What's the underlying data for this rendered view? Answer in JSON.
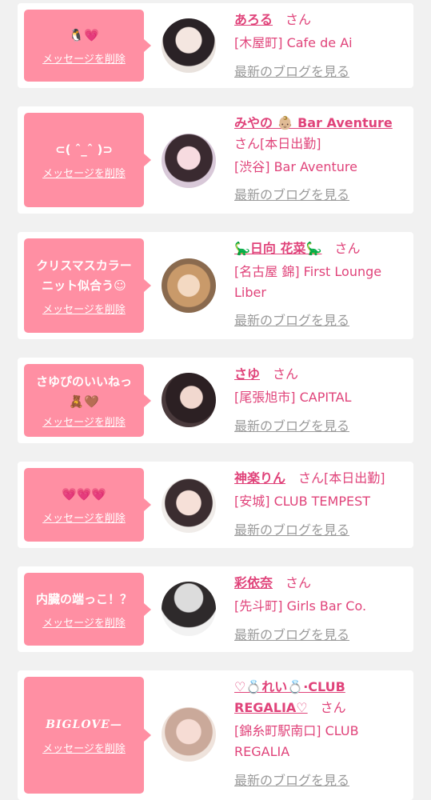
{
  "entries": [
    {
      "message": "🐧💗",
      "delete_label": "メッセージを削除",
      "name": "あろる",
      "honorific": "さん",
      "status": "",
      "shop": "[木屋町] Cafe de Ai",
      "blog_label": "最新のブログを見る"
    },
    {
      "message": "⊂( ˆ_ˆ )⊃",
      "delete_label": "メッセージを削除",
      "name": "みやの 👶🏼 Bar Aventure",
      "honorific": "さん",
      "status": "[本日出勤]",
      "shop": "[渋谷] Bar Aventure",
      "blog_label": "最新のブログを見る"
    },
    {
      "message": "クリスマスカラーニット似合う☺",
      "delete_label": "メッセージを削除",
      "name": "🦕日向 花菜🦕",
      "honorific": "さん",
      "status": "",
      "shop": "[名古屋 錦] First Lounge Liber",
      "blog_label": "最新のブログを見る"
    },
    {
      "message": "さゆぴのいいねっ🧸🤎",
      "delete_label": "メッセージを削除",
      "name": "さゆ",
      "honorific": "さん",
      "status": "",
      "shop": "[尾張旭市] CAPITAL",
      "blog_label": "最新のブログを見る"
    },
    {
      "message": "💗💗💗",
      "delete_label": "メッセージを削除",
      "name": "神楽りん",
      "honorific": "さん",
      "status": "[本日出勤]",
      "shop": "[安城] CLUB TEMPEST",
      "blog_label": "最新のブログを見る"
    },
    {
      "message": "内臓の端っこ！？",
      "delete_label": "メッセージを削除",
      "name": "彩依奈",
      "honorific": "さん",
      "status": "",
      "shop": "[先斗町] Girls Bar Co.",
      "blog_label": "最新のブログを見る"
    },
    {
      "message": "BIGLOVE—",
      "delete_label": "メッセージを削除",
      "name": "♡💍れい💍·CLUB REGALIA♡",
      "honorific": "さん",
      "status": "",
      "shop": "[錦糸町駅南口] CLUB REGALIA",
      "blog_label": "最新のブログを見る"
    }
  ],
  "colors": {
    "bubble": "#ff8fa3",
    "name": "#e0437a",
    "blog_link": "#9a9a9a",
    "background": "#f1f1f1"
  }
}
